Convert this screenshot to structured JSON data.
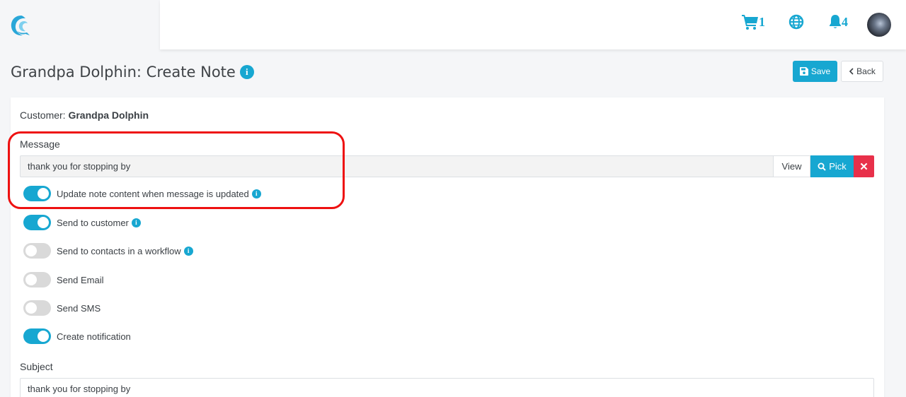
{
  "topbar": {
    "cart_count": "1",
    "notif_count": "4"
  },
  "header": {
    "title": "Grandpa Dolphin: Create Note",
    "save_label": "Save",
    "back_label": "Back"
  },
  "form": {
    "customer_label": "Customer:",
    "customer_name": "Grandpa Dolphin",
    "message_label": "Message",
    "message_value": "thank you for stopping by",
    "view_label": "View",
    "pick_label": "Pick",
    "toggles": [
      {
        "label": "Update note content when message is updated",
        "on": true,
        "info": true
      },
      {
        "label": "Send to customer",
        "on": true,
        "info": true
      },
      {
        "label": "Send to contacts in a workflow",
        "on": false,
        "info": true
      },
      {
        "label": "Send Email",
        "on": false,
        "info": false
      },
      {
        "label": "Send SMS",
        "on": false,
        "info": false
      },
      {
        "label": "Create notification",
        "on": true,
        "info": false
      }
    ],
    "subject_label": "Subject",
    "subject_value": "thank you for stopping by"
  },
  "colors": {
    "accent": "#17a7d1",
    "danger": "#e8304a",
    "highlight": "#ee1111"
  }
}
